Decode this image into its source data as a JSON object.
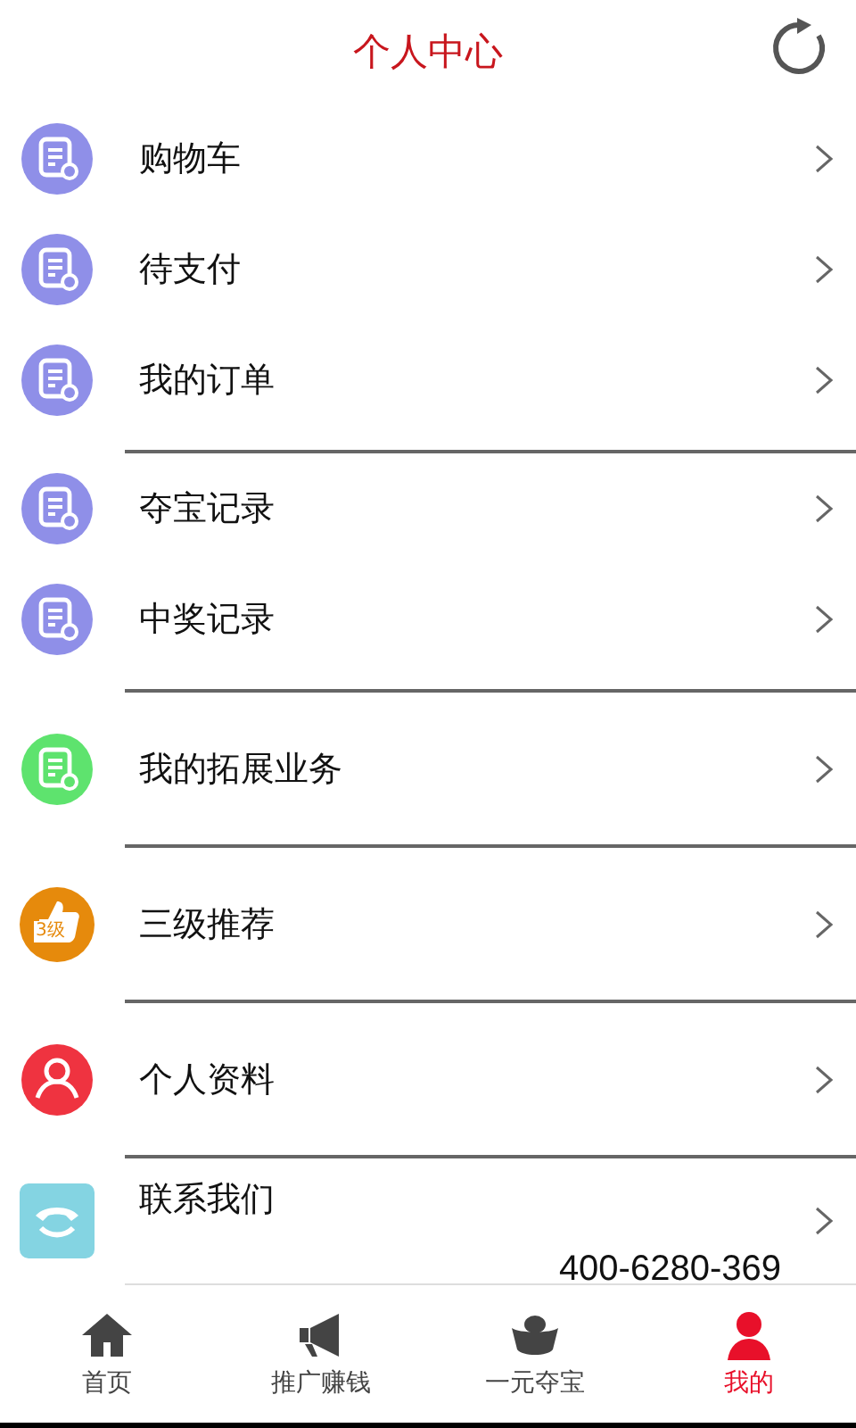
{
  "header": {
    "title": "个人中心"
  },
  "groups": [
    {
      "items": [
        {
          "label": "购物车",
          "kind": "doc",
          "color": "#8f8fe8"
        },
        {
          "label": "待支付",
          "kind": "doc",
          "color": "#8f8fe8"
        },
        {
          "label": "我的订单",
          "kind": "doc",
          "color": "#8f8fe8"
        }
      ]
    },
    {
      "items": [
        {
          "label": "夺宝记录",
          "kind": "doc",
          "color": "#8f8fe8"
        },
        {
          "label": "中奖记录",
          "kind": "doc",
          "color": "#8f8fe8"
        }
      ]
    },
    {
      "items": [
        {
          "label": "我的拓展业务",
          "kind": "check",
          "color": "#5ee36e"
        }
      ]
    },
    {
      "items": [
        {
          "label": "三级推荐",
          "kind": "thumb",
          "color": "#e68a0c",
          "badge": "3级"
        }
      ]
    },
    {
      "items": [
        {
          "label": "个人资料",
          "kind": "person",
          "color": "#ef3340"
        }
      ]
    },
    {
      "items": [
        {
          "label": "联系我们",
          "kind": "phone",
          "color": "#84d4e2",
          "phone": "400-6280-369"
        }
      ]
    }
  ],
  "tabs": [
    {
      "label": "首页",
      "kind": "home",
      "selected": false
    },
    {
      "label": "推广赚钱",
      "kind": "megaphone",
      "selected": false
    },
    {
      "label": "一元夺宝",
      "kind": "ingot",
      "selected": false
    },
    {
      "label": "我的",
      "kind": "person",
      "selected": true
    }
  ]
}
